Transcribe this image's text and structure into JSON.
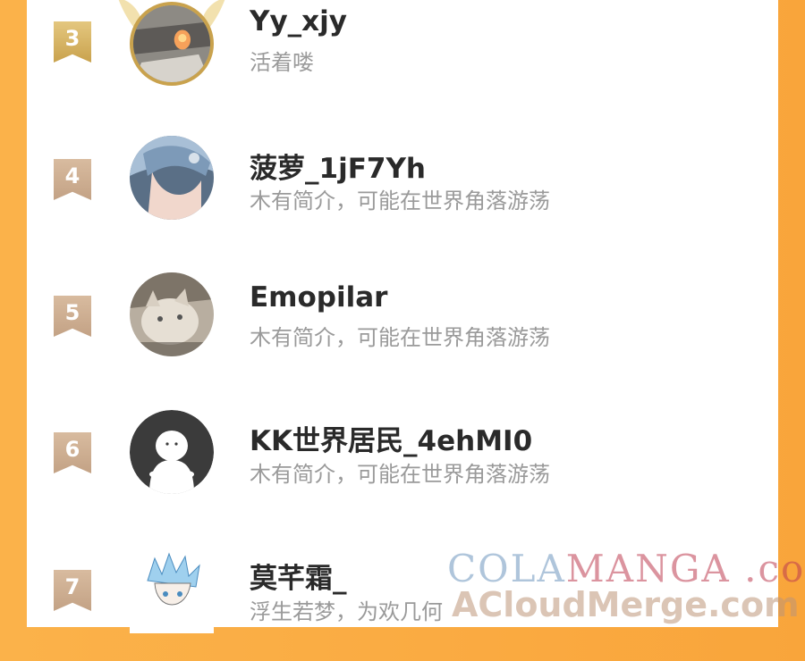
{
  "colors": {
    "background": "#f9a53b",
    "panel": "#ffffff",
    "name_text": "#2a2a2a",
    "bio_text": "#9a9a9a",
    "rank_gold": "#d4b062",
    "rank_plain": "#cbae92"
  },
  "users": [
    {
      "rank": "3",
      "name": "Yy_xjy",
      "bio": "活着喽",
      "avatar": "photo-avatar-with-gold-wings"
    },
    {
      "rank": "4",
      "name": "菠萝_1jF7Yh",
      "bio": "木有简介，可能在世界角落游荡",
      "avatar": "anime-boy-avatar"
    },
    {
      "rank": "5",
      "name": "Emopilar",
      "bio": "木有简介，可能在世界角落游荡",
      "avatar": "cat-photo-avatar"
    },
    {
      "rank": "6",
      "name": "KK世界居民_4ehMI0",
      "bio": "木有简介，可能在世界角落游荡",
      "avatar": "default-person-avatar"
    },
    {
      "rank": "7",
      "name": "莫芊霜_",
      "bio": "浮生若梦，为欢几何",
      "avatar": "anime-sketch-avatar"
    }
  ],
  "watermark": {
    "line1_part1": "COLA",
    "line1_part2": "MANGA",
    "line1_part3": " .com",
    "line2": "ACloudMerge.com"
  }
}
